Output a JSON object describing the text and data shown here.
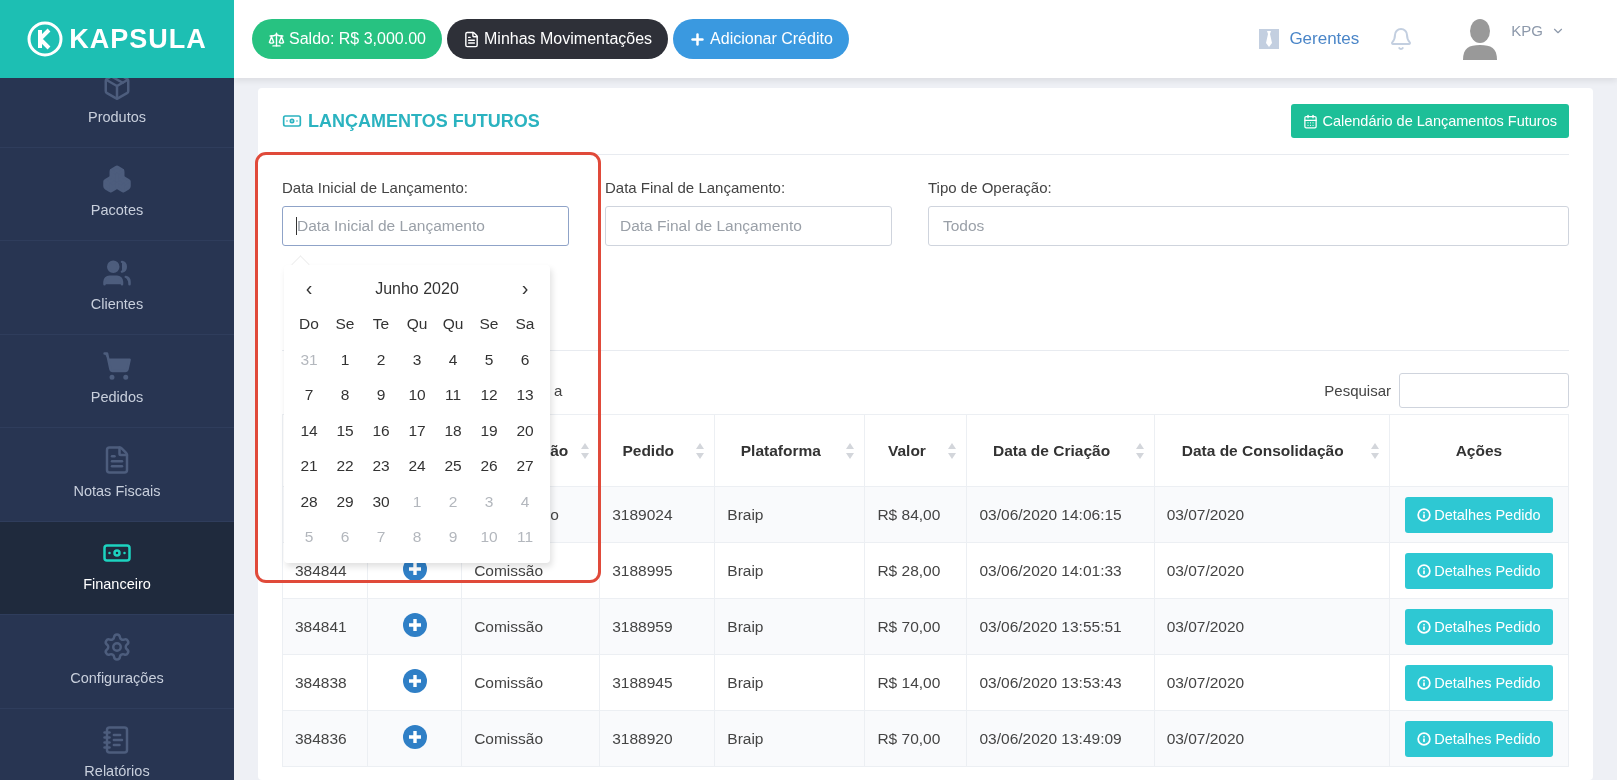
{
  "brand": {
    "logo_text": "KAPSULA"
  },
  "topbar": {
    "buttons": [
      {
        "kind": "balance",
        "label": "Saldo: R$ 3,000.00"
      },
      {
        "kind": "statement",
        "label": "Minhas Movimentações"
      },
      {
        "kind": "credit",
        "label": "Adicionar Crédito"
      }
    ],
    "managers_link": "Gerentes",
    "user": "KPG"
  },
  "sidebar": {
    "items": [
      {
        "kind": "box",
        "label": "Produtos",
        "selected": false
      },
      {
        "kind": "boxes",
        "label": "Pacotes",
        "selected": false
      },
      {
        "kind": "users",
        "label": "Clientes",
        "selected": false
      },
      {
        "kind": "cart",
        "label": "Pedidos",
        "selected": false
      },
      {
        "kind": "pdf",
        "label": "Notas Fiscais",
        "selected": false
      },
      {
        "kind": "money",
        "label": "Financeiro",
        "selected": true
      },
      {
        "kind": "gear",
        "label": "Configurações",
        "selected": false
      },
      {
        "kind": "notebook",
        "label": "Relatórios",
        "selected": false
      }
    ]
  },
  "page": {
    "title": "LANÇAMENTOS FUTUROS",
    "calendar_button": "Calendário de Lançamentos Futuros"
  },
  "filters": [
    {
      "label": "Data Inicial de Lançamento:",
      "placeholder": "Data Inicial de Lançamento",
      "focused": true
    },
    {
      "label": "Data Final de Lançamento:",
      "placeholder": "Data Final de Lançamento",
      "focused": false
    },
    {
      "label": "Tipo de Operação:",
      "placeholder": "Todos",
      "focused": false
    }
  ],
  "datepicker": {
    "prev": "‹",
    "next": "›",
    "month": "Junho 2020",
    "weekdays": [
      "Do",
      "Se",
      "Te",
      "Qu",
      "Qu",
      "Se",
      "Sa"
    ],
    "weeks": [
      [
        {
          "day": "31",
          "muted": true
        },
        {
          "day": "1",
          "muted": false
        },
        {
          "day": "2",
          "muted": false
        },
        {
          "day": "3",
          "muted": false
        },
        {
          "day": "4",
          "muted": false
        },
        {
          "day": "5",
          "muted": false
        },
        {
          "day": "6",
          "muted": false
        }
      ],
      [
        {
          "day": "7",
          "muted": false
        },
        {
          "day": "8",
          "muted": false
        },
        {
          "day": "9",
          "muted": false
        },
        {
          "day": "10",
          "muted": false
        },
        {
          "day": "11",
          "muted": false
        },
        {
          "day": "12",
          "muted": false
        },
        {
          "day": "13",
          "muted": false
        }
      ],
      [
        {
          "day": "14",
          "muted": false
        },
        {
          "day": "15",
          "muted": false
        },
        {
          "day": "16",
          "muted": false
        },
        {
          "day": "17",
          "muted": false
        },
        {
          "day": "18",
          "muted": false
        },
        {
          "day": "19",
          "muted": false
        },
        {
          "day": "20",
          "muted": false
        }
      ],
      [
        {
          "day": "21",
          "muted": false
        },
        {
          "day": "22",
          "muted": false
        },
        {
          "day": "23",
          "muted": false
        },
        {
          "day": "24",
          "muted": false
        },
        {
          "day": "25",
          "muted": false
        },
        {
          "day": "26",
          "muted": false
        },
        {
          "day": "27",
          "muted": false
        }
      ],
      [
        {
          "day": "28",
          "muted": false
        },
        {
          "day": "29",
          "muted": false
        },
        {
          "day": "30",
          "muted": false
        },
        {
          "day": "1",
          "muted": true
        },
        {
          "day": "2",
          "muted": true
        },
        {
          "day": "3",
          "muted": true
        },
        {
          "day": "4",
          "muted": true
        }
      ],
      [
        {
          "day": "5",
          "muted": true
        },
        {
          "day": "6",
          "muted": true
        },
        {
          "day": "7",
          "muted": true
        },
        {
          "day": "8",
          "muted": true
        },
        {
          "day": "9",
          "muted": true
        },
        {
          "day": "10",
          "muted": true
        },
        {
          "day": "11",
          "muted": true
        }
      ]
    ]
  },
  "table_toolbar": {
    "length_label": "a",
    "search_label": "Pesquisar"
  },
  "table": {
    "columns": [
      {},
      {},
      {
        "label": "ão",
        "sortable": true
      },
      {
        "label": "Pedido",
        "sortable": true
      },
      {
        "label": "Plataforma",
        "sortable": true
      },
      {
        "label": "Valor",
        "sortable": true
      },
      {
        "label": "Data de Criação",
        "sortable": true
      },
      {
        "label": "Data de Consolidação",
        "sortable": true
      },
      {
        "label": "Ações",
        "sortable": false
      }
    ],
    "rows": [
      {
        "tipo": "o",
        "pedido": "3189024",
        "plataforma": "Braip",
        "valor": "R$ 84,00",
        "criacao": "03/06/2020 14:06:15",
        "consolidacao": "03/07/2020",
        "action": "Detalhes Pedido"
      },
      {
        "id": "384844",
        "expand": true,
        "tipo": "Comissão",
        "pedido": "3188995",
        "plataforma": "Braip",
        "valor": "R$ 28,00",
        "criacao": "03/06/2020 14:01:33",
        "consolidacao": "03/07/2020",
        "action": "Detalhes Pedido"
      },
      {
        "id": "384841",
        "expand": true,
        "tipo": "Comissão",
        "pedido": "3188959",
        "plataforma": "Braip",
        "valor": "R$ 70,00",
        "criacao": "03/06/2020 13:55:51",
        "consolidacao": "03/07/2020",
        "action": "Detalhes Pedido"
      },
      {
        "id": "384838",
        "expand": true,
        "tipo": "Comissão",
        "pedido": "3188945",
        "plataforma": "Braip",
        "valor": "R$ 14,00",
        "criacao": "03/06/2020 13:53:43",
        "consolidacao": "03/07/2020",
        "action": "Detalhes Pedido"
      },
      {
        "id": "384836",
        "expand": true,
        "tipo": "Comissão",
        "pedido": "3188920",
        "plataforma": "Braip",
        "valor": "R$ 70,00",
        "criacao": "03/06/2020 13:49:09",
        "consolidacao": "03/07/2020",
        "action": "Detalhes Pedido"
      }
    ]
  }
}
